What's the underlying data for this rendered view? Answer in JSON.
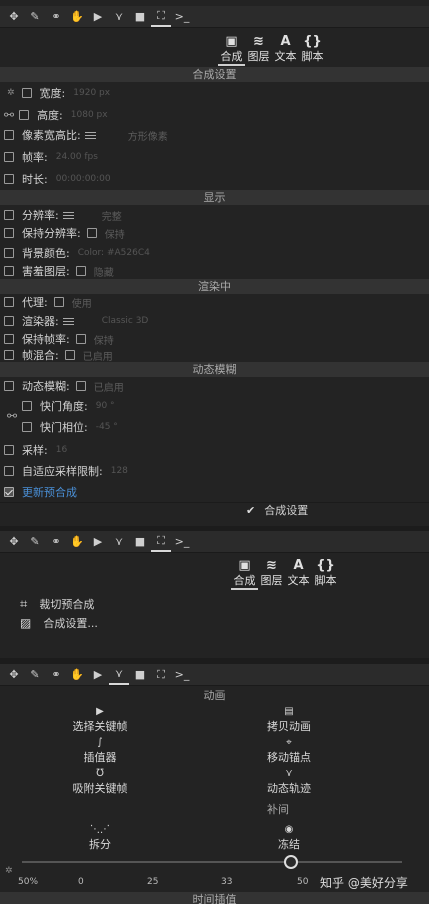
{
  "toolbar_icons": [
    "transform-icon",
    "brush-icon",
    "link-icon",
    "hand-icon",
    "play-icon",
    "motion-path-icon",
    "camera-icon",
    "comp-settings-icon",
    "expression-icon"
  ],
  "tabs": {
    "comp": "合成",
    "layer": "图层",
    "text": "文本",
    "script": "脚本"
  },
  "panel1": {
    "sec_comp": "合成设置",
    "width_label": "宽度:",
    "width_value": "1920 px",
    "height_label": "高度:",
    "height_value": "1080 px",
    "par_label": "像素宽高比:",
    "par_value": "方形像素",
    "fps_label": "帧率:",
    "fps_value": "24.00 fps",
    "duration_label": "时长:",
    "duration_value": "00:00:00:00",
    "sec_display": "显示",
    "res_label": "分辨率:",
    "res_value": "完整",
    "keepres_label": "保持分辨率:",
    "keepres_value": "保持",
    "bg_label": "背景颜色:",
    "bg_value": "Color: #A526C4",
    "shy_label": "害羞图层:",
    "shy_value": "隐藏",
    "sec_render": "渲染中",
    "proxy_label": "代理:",
    "proxy_value": "使用",
    "renderer_label": "渲染器:",
    "renderer_value": "Classic 3D",
    "keepfps_label": "保持帧率:",
    "keepfps_value": "保持",
    "blend_label": "帧混合:",
    "blend_value": "已启用",
    "sec_mb": "动态模糊",
    "mb_label": "动态模糊:",
    "mb_value": "已启用",
    "shutter_angle_label": "快门角度:",
    "shutter_angle_value": "90 °",
    "shutter_phase_label": "快门相位:",
    "shutter_phase_value": "-45 °",
    "samples_label": "采样:",
    "samples_value": "16",
    "adaptive_label": "自适应采样限制:",
    "adaptive_value": "128",
    "update_label": "更新预合成",
    "footer": "合成设置"
  },
  "panel2": {
    "crop_label": "裁切预合成",
    "settings_label": "合成设置..."
  },
  "panel3": {
    "sec_anim": "动画",
    "select_kf": "选择关键帧",
    "copy_anim": "拷贝动画",
    "interpolator": "插值器",
    "move_anchor": "移动锚点",
    "snap_kf": "吸附关键帧",
    "motion_path": "动态轨迹",
    "sec_tween": "补间",
    "split": "拆分",
    "freeze": "冻结",
    "zoom": "50%",
    "ticks": [
      "0",
      "25",
      "33",
      "50"
    ],
    "sec_bottom": "时间插值"
  },
  "watermark": "知乎 @美好分享"
}
